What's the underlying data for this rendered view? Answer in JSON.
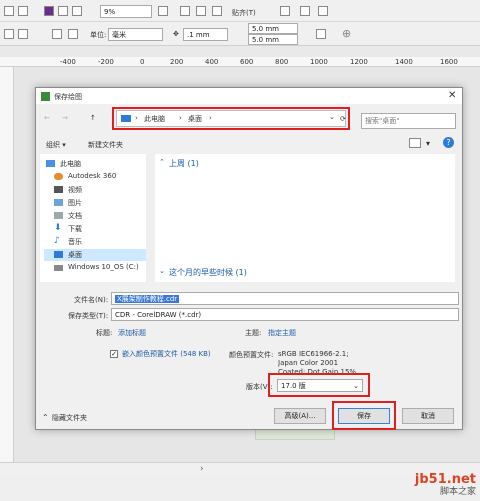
{
  "toolbar1": {
    "zoom_value": "9%",
    "paste_label": "贴齐(T)"
  },
  "toolbar2": {
    "unit_label": "单位:",
    "unit_value": "毫米",
    "nudge_value": ".1 mm",
    "dup_x": "5.0 mm",
    "dup_y": "5.0 mm"
  },
  "ruler": {
    "ticks": [
      "-400",
      "-200",
      "0",
      "200",
      "400",
      "600",
      "800",
      "1000",
      "1200",
      "1400",
      "1600"
    ]
  },
  "dialog": {
    "title": "保存绘图",
    "breadcrumb": [
      "此电脑",
      "桌面"
    ],
    "search_placeholder": "搜索\"桌面\"",
    "organize_label": "组织 ▾",
    "new_folder_label": "新建文件夹",
    "nav_items": [
      {
        "label": "此电脑",
        "icon": "computer-icon"
      },
      {
        "label": "Autodesk 360",
        "icon": "cloud-icon"
      },
      {
        "label": "视频",
        "icon": "video-icon"
      },
      {
        "label": "图片",
        "icon": "picture-icon"
      },
      {
        "label": "文档",
        "icon": "document-icon"
      },
      {
        "label": "下载",
        "icon": "download-icon"
      },
      {
        "label": "音乐",
        "icon": "music-icon"
      },
      {
        "label": "桌面",
        "icon": "desktop-icon"
      },
      {
        "label": "Windows 10_OS (C:)",
        "icon": "drive-icon"
      }
    ],
    "groups": [
      {
        "label": "上周 (1)"
      },
      {
        "label": "这个月的早些时候 (1)"
      }
    ],
    "filename_label": "文件名(N):",
    "filename_value": "X展架制作教程.cdr",
    "filetype_label": "保存类型(T):",
    "filetype_value": "CDR - CorelDRAW (*.cdr)",
    "tags_label": "标题:",
    "tags_value": "添加标题",
    "subject_label": "主题:",
    "subject_value": "指定主题",
    "embed_label": "嵌入颜色预置文件 (548 KB)",
    "color_profile_label": "颜色预置文件:",
    "color_profile_lines": [
      "sRGB IEC61966-2.1;",
      "Japan Color 2001",
      "Coated; Dot Gain 15%"
    ],
    "version_label": "版本(V):",
    "version_value": "17.0 版",
    "advanced_label": "高级(A)...",
    "save_label": "保存",
    "cancel_label": "取消",
    "hide_folders_label": "隐藏文件夹"
  },
  "watermark": {
    "line1": "jb51.net",
    "line2": "脚本之家"
  }
}
